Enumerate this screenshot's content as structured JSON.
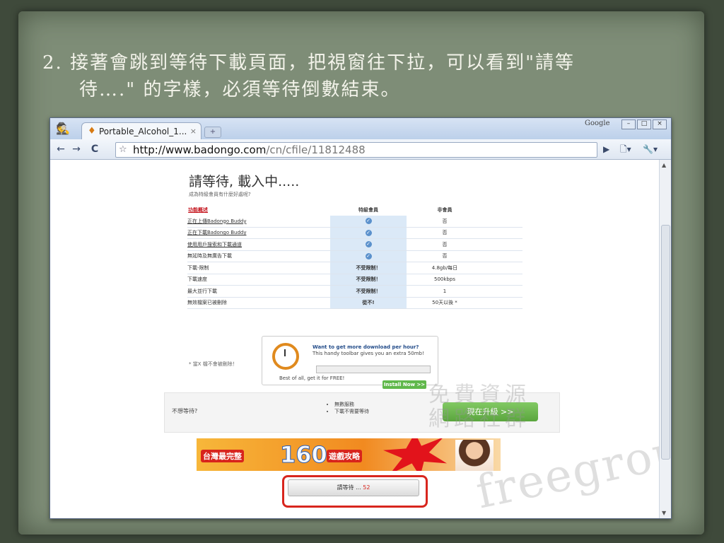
{
  "slide": {
    "line1": "2.  接著會跳到等待下載頁面，把視窗往下拉，可以看到\"請等",
    "line2": "待….\" 的字樣，必須等待倒數結束。"
  },
  "browser": {
    "tab_title": "Portable_Alcohol_1...",
    "tab_close": "×",
    "google_label": "Google",
    "url_host": "http://www.badongo.com",
    "url_path": "/cn/cfile/11812488",
    "icons": [
      "back-arrow-icon",
      "forward-arrow-icon",
      "reload-icon",
      "star-icon",
      "play-icon",
      "page-icon",
      "wrench-icon",
      "incognito-icon"
    ]
  },
  "page": {
    "heading": "請等待, 載入中.....",
    "subheading": "成為特級會員有什麼好處呢?",
    "table": {
      "headers": [
        "功能概述",
        "特級會員",
        "非會員"
      ],
      "rows": [
        [
          "正在上傳Badongo Buddy",
          "✓",
          "否"
        ],
        [
          "正在下載Badongo Buddy",
          "✓",
          "否"
        ],
        [
          "使用用戶搜索和下載通道",
          "✓",
          "否"
        ],
        [
          "無延時及無廣告下載",
          "✓",
          "否"
        ],
        [
          "下載-限制",
          "不受限制！",
          "4.8gb/每日"
        ],
        [
          "下載速度",
          "不受限制！",
          "500kbps"
        ],
        [
          "最大並行下載",
          "不受限制！",
          "1"
        ],
        [
          "無效檔案已被刪除",
          "從不!",
          "50天以後 *"
        ]
      ]
    },
    "note": "* 當X 檔不會被刪除！",
    "promo": {
      "title": "Want to get more download per hour?",
      "desc": "This handy toolbar gives you an extra 50mb!",
      "best": "Best of all, get it for FREE!",
      "install": "Install Now >>"
    },
    "upgrade": {
      "question": "不想等待?",
      "bullets": [
        "無數服務",
        "下載不需要等待"
      ],
      "button": "現在升級 >>"
    },
    "banner": {
      "left": "台灣最完整",
      "number": "160",
      "right": "遊戲攻略"
    },
    "wait_label": "請等待 ...",
    "wait_count": "52",
    "watermark_line1": "免費資源",
    "watermark_line2": "網路社群",
    "watermark_latin": "freegroup"
  },
  "colors": {
    "slide_bg": "#7e8d77",
    "accent_red": "#d8261e",
    "vip_column": "#dbe9f7"
  }
}
